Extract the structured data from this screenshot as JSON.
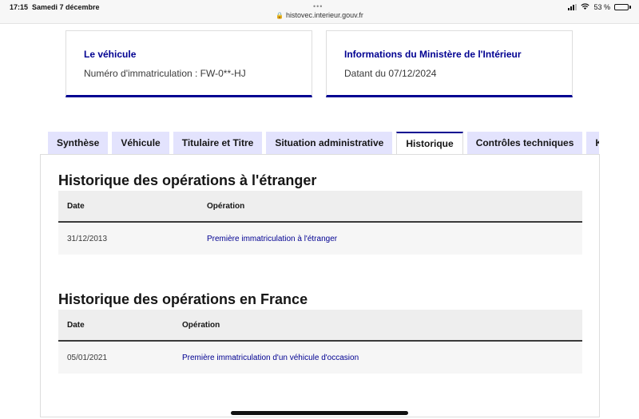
{
  "status_bar": {
    "time": "17:15",
    "date": "Samedi 7 décembre",
    "url": "histovec.interieur.gouv.fr",
    "battery": "53 %",
    "battery_level": 0.53
  },
  "cards": {
    "vehicle": {
      "title": "Le véhicule",
      "text": "Numéro d'immatriculation : FW-0**-HJ"
    },
    "ministry": {
      "title": "Informations du Ministère de l'Intérieur",
      "text": "Datant du 07/12/2024"
    }
  },
  "tabs": [
    {
      "label": "Synthèse"
    },
    {
      "label": "Véhicule"
    },
    {
      "label": "Titulaire et Titre"
    },
    {
      "label": "Situation administrative"
    },
    {
      "label": "Historique"
    },
    {
      "label": "Contrôles techniques"
    },
    {
      "label": "Kilométrage"
    }
  ],
  "active_tab": "Historique",
  "foreign_history": {
    "title": "Historique des opérations à l'étranger",
    "columns": [
      "Date",
      "Opération"
    ],
    "rows": [
      {
        "date": "31/12/2013",
        "operation": "Première immatriculation à l'étranger"
      }
    ]
  },
  "france_history": {
    "title": "Historique des opérations en France",
    "columns": [
      "Date",
      "Opération"
    ],
    "rows": [
      {
        "date": "05/01/2021",
        "operation": "Première immatriculation d'un véhicule d'occasion"
      }
    ]
  },
  "colors": {
    "accent": "#000091",
    "tab_bg": "#e3e3fd",
    "table_bg": "#f6f6f6"
  }
}
